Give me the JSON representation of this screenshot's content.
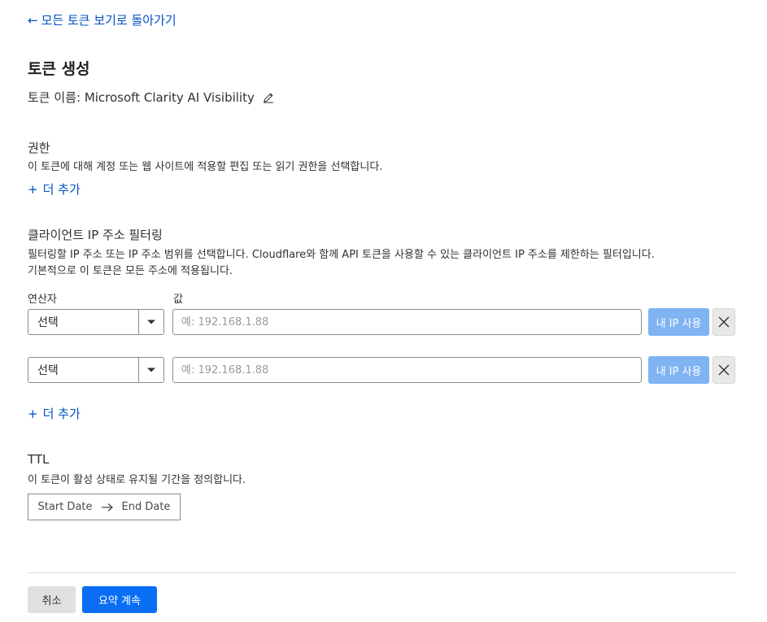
{
  "nav": {
    "back_label": "모든 토큰 보기로 돌아가기"
  },
  "page": {
    "title": "토큰 생성",
    "token_name_prefix": "토큰 이름:",
    "token_name": "Microsoft Clarity AI Visibility"
  },
  "permissions": {
    "title": "권한",
    "description": "이 토큰에 대해 계정 또는 웹 사이트에 적용할 편집 또는 읽기 권한을 선택합니다.",
    "add_more_label": "더 추가"
  },
  "ip_filter": {
    "title": "클라이언트 IP 주소 필터링",
    "description_line1": "필터링할 IP 주소 또는 IP 주소 범위를 선택합니다. Cloudflare와 함께 API 토큰을 사용할 수 있는 클라이언트 IP 주소를 제한하는 필터입니다.",
    "description_line2": "기본적으로 이 토큰은 모든 주소에 적용됩니다.",
    "operator_label": "연산자",
    "value_label": "값",
    "rows": [
      {
        "operator": "선택",
        "value": "",
        "placeholder": "예: 192.168.1.88",
        "my_ip_label": "내 IP 사용"
      },
      {
        "operator": "선택",
        "value": "",
        "placeholder": "예: 192.168.1.88",
        "my_ip_label": "내 IP 사용"
      }
    ],
    "add_more_label": "더 추가"
  },
  "ttl": {
    "title": "TTL",
    "description": "이 토큰이 활성 상태로 유지될 기간을 정의합니다.",
    "start_placeholder": "Start Date",
    "end_placeholder": "End Date"
  },
  "footer": {
    "cancel_label": "취소",
    "continue_label": "요약 계속"
  },
  "icons": {
    "back": "arrow-left-icon",
    "edit": "pencil-icon",
    "add": "plus-icon",
    "dropdown": "chevron-down-icon",
    "remove": "close-icon",
    "range": "arrow-right-icon"
  },
  "colors": {
    "link": "#0051c3",
    "primary_button": "#0a6ef5",
    "disabled_button": "#7fb3f2",
    "text": "#313131"
  }
}
